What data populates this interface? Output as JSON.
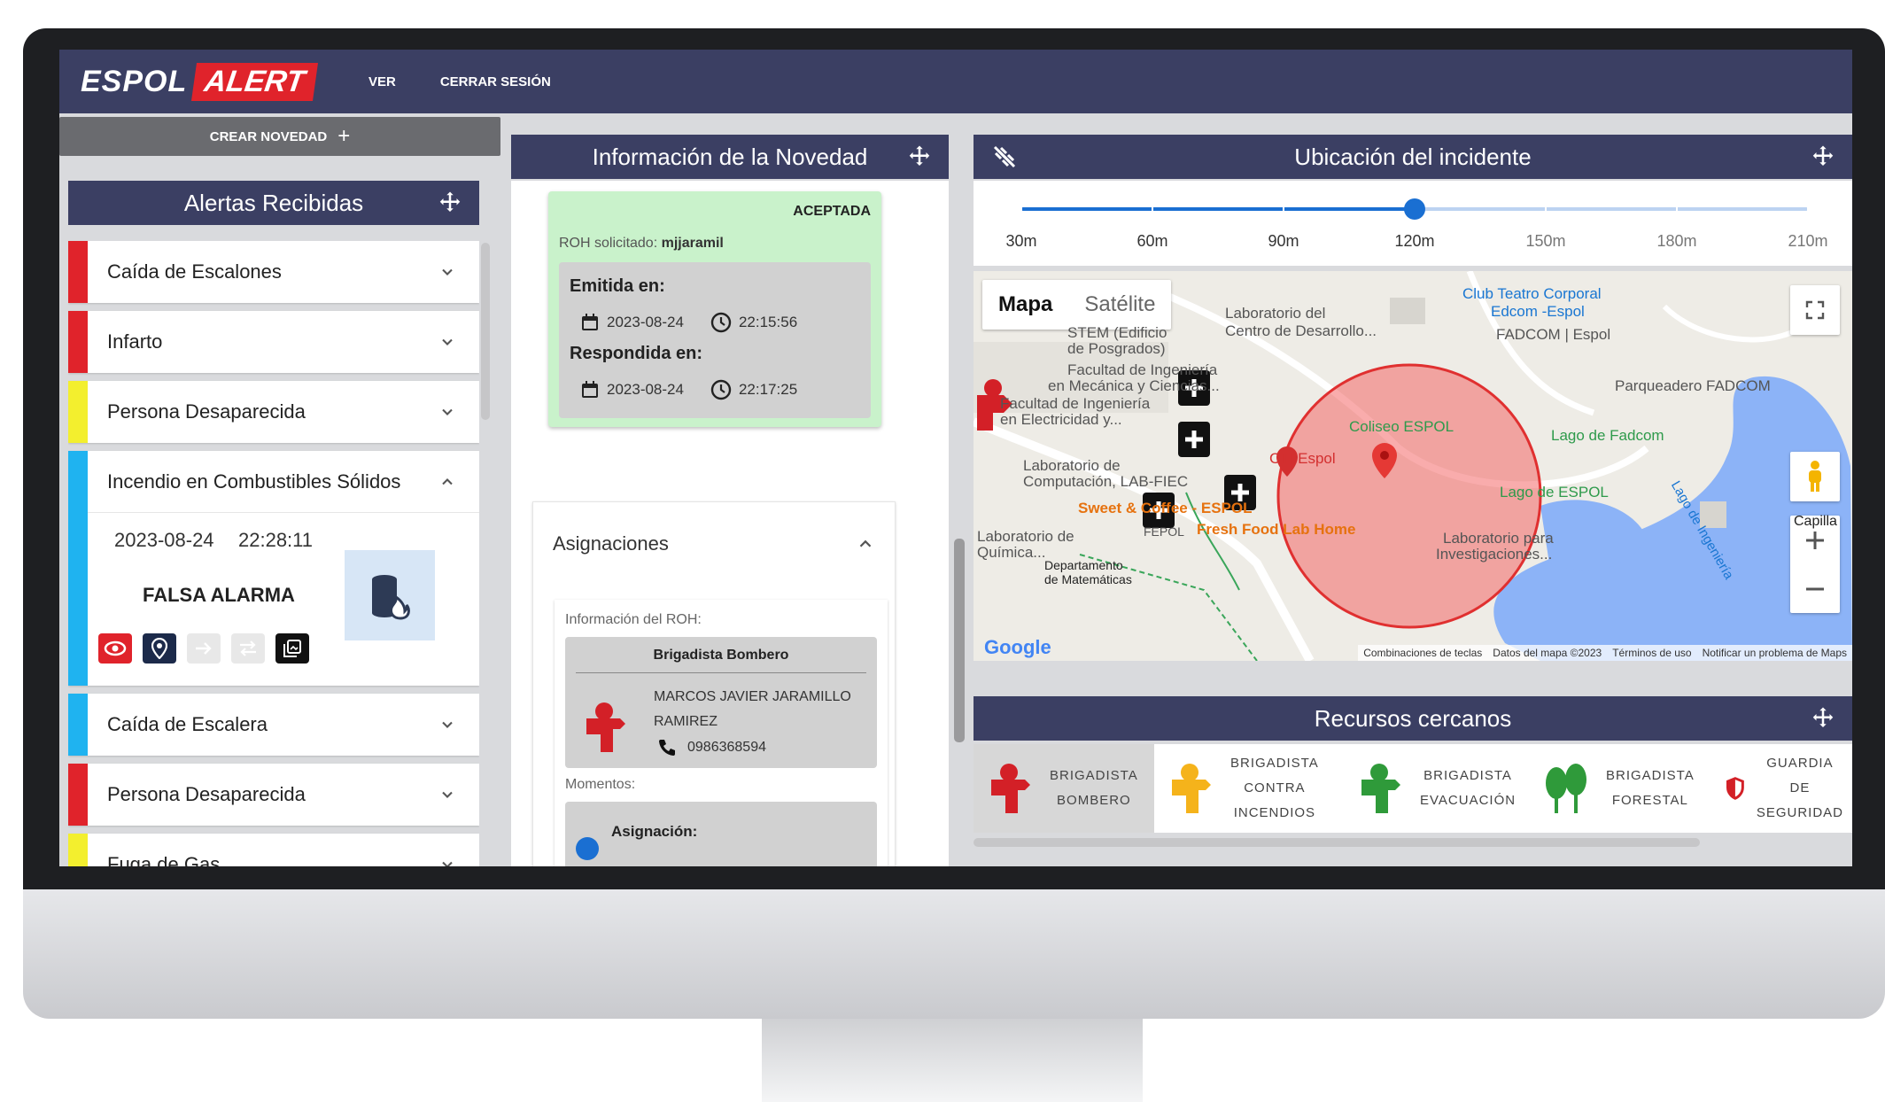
{
  "app": {
    "brand_part1": "ESPOL",
    "brand_part2": "ALERT",
    "nav": [
      "VER",
      "CERRAR SESIÓN"
    ],
    "colors": {
      "navy": "#3b3f63",
      "brand_red": "#e0232b",
      "accepted_green": "#c9f2cb",
      "slider_blue": "#1a6fd2"
    }
  },
  "left": {
    "create_button": "CREAR NOVEDAD",
    "panel_title": "Alertas Recibidas",
    "alerts": [
      {
        "label": "Caída de Escalones",
        "color": "#e0232b"
      },
      {
        "label": "Infarto",
        "color": "#e0232b"
      },
      {
        "label": "Persona Desaparecida",
        "color": "#f3ef2e"
      },
      {
        "label": "Incendio en Combustibles Sólidos",
        "color": "#1fb3f0",
        "expanded": true
      },
      {
        "label": "Caída de Escalera",
        "color": "#1fb3f0"
      },
      {
        "label": "Persona Desaparecida",
        "color": "#e0232b"
      },
      {
        "label": "Fuga de Gas",
        "color": "#f3ef2e"
      }
    ],
    "expanded_detail": {
      "date": "2023-08-24",
      "time": "22:28:11",
      "status": "FALSA ALARMA",
      "icon": "fire-barrel-icon",
      "actions": [
        "eye-icon",
        "location-pin-icon",
        "arrow-right-icon",
        "swap-icon",
        "gallery-icon"
      ]
    }
  },
  "middle": {
    "panel_title": "Información de la Novedad",
    "status": {
      "badge": "ACEPTADA",
      "requested_label": "ROH solicitado:",
      "requested_user": "mjjaramil",
      "emitted_label": "Emitida en:",
      "emitted_date": "2023-08-24",
      "emitted_time": "22:15:56",
      "responded_label": "Respondida en:",
      "responded_date": "2023-08-24",
      "responded_time": "22:17:25"
    },
    "assignments": {
      "title": "Asignaciones",
      "roh_info_label": "Información del ROH:",
      "roh_role": "Brigadista Bombero",
      "roh_name": "MARCOS JAVIER JARAMILLO RAMIREZ",
      "roh_phone": "0986368594",
      "moments_label": "Momentos:",
      "moment_title": "Asignación:"
    }
  },
  "right": {
    "panel_title": "Ubicación del incidente",
    "radius_options": [
      "30m",
      "60m",
      "90m",
      "120m",
      "150m",
      "180m",
      "210m"
    ],
    "radius_selected": "120m",
    "map": {
      "tabs": [
        "Mapa",
        "Satélite"
      ],
      "active_tab": "Mapa",
      "places": [
        {
          "text": "Laboratorio del",
          "cls": "gray"
        },
        {
          "text": "Centro de Desarrollo...",
          "cls": "gray"
        },
        {
          "text": "Club Teatro Corporal",
          "cls": "blue"
        },
        {
          "text": "Edcom -Espol",
          "cls": "blue"
        },
        {
          "text": "FADCOM | Espol",
          "cls": "gray"
        },
        {
          "text": "STEM (Edificio",
          "cls": "gray"
        },
        {
          "text": "de Posgrados)",
          "cls": "gray"
        },
        {
          "text": "Facultad de Ingeniería",
          "cls": "gray"
        },
        {
          "text": "en Mecánica y Ciencias...",
          "cls": "gray"
        },
        {
          "text": "Facultad de Ingeniería",
          "cls": "gray"
        },
        {
          "text": "en Electricidad y...",
          "cls": "gray"
        },
        {
          "text": "Parqueadero FADCOM",
          "cls": "gray"
        },
        {
          "text": "Lago de Fadcom",
          "cls": "green"
        },
        {
          "text": "Coliseo ESPOL",
          "cls": "green"
        },
        {
          "text": "Laboratorio de",
          "cls": "gray"
        },
        {
          "text": "Computación, LAB-FIEC",
          "cls": "gray"
        },
        {
          "text": "CTI Espol",
          "cls": "red"
        },
        {
          "text": "Lago de ESPOL",
          "cls": "green"
        },
        {
          "text": "Sweet & Coffee - ESPOL",
          "cls": "orange"
        },
        {
          "text": "Fresh Food Lab Home",
          "cls": "orange"
        },
        {
          "text": "FEPOL",
          "cls": "gray"
        },
        {
          "text": "Laboratorio para",
          "cls": "gray"
        },
        {
          "text": "Investigaciones...",
          "cls": "gray"
        },
        {
          "text": "Lago de Ingeniería",
          "cls": "blue"
        },
        {
          "text": "Departamento",
          "cls": "gray"
        },
        {
          "text": "de Matemáticas",
          "cls": "gray"
        },
        {
          "text": "Laboratorio de",
          "cls": "gray"
        },
        {
          "text": "Química...",
          "cls": "gray"
        },
        {
          "text": "Capilla",
          "cls": "gray"
        }
      ],
      "footer": [
        "Combinaciones de teclas",
        "Datos del mapa ©2023",
        "Términos de uso",
        "Notificar un problema de Maps"
      ],
      "google_logo": "Google"
    }
  },
  "recursos": {
    "panel_title": "Recursos cercanos",
    "items": [
      {
        "l1": "BRIGADISTA",
        "l2": "BOMBERO",
        "l3": "",
        "color": "#d32027",
        "selected": true
      },
      {
        "l1": "BRIGADISTA",
        "l2": "CONTRA",
        "l3": "INCENDIOS",
        "color": "#f5b31b"
      },
      {
        "l1": "BRIGADISTA",
        "l2": "EVACUACIÓN",
        "l3": "",
        "color": "#2f9a3a"
      },
      {
        "l1": "BRIGADISTA",
        "l2": "FORESTAL",
        "l3": "",
        "color": "#2f9a3a"
      },
      {
        "l1": "GUARDIA",
        "l2": "DE",
        "l3": "SEGURIDAD",
        "color": "#d32027"
      }
    ]
  }
}
